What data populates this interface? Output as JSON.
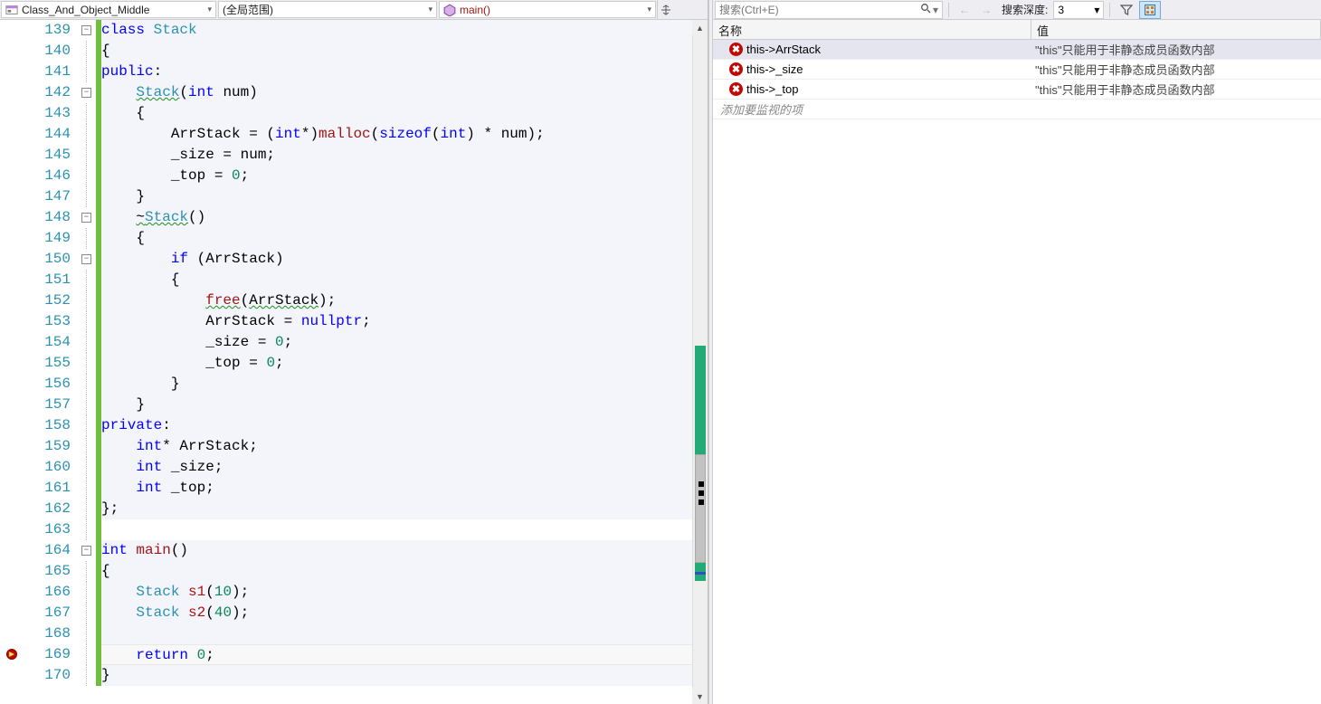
{
  "nav": {
    "project": "Class_And_Object_Middle",
    "scope": "(全局范围)",
    "func": "main()"
  },
  "editor": {
    "lines": [
      {
        "n": 139,
        "fold": "minus",
        "hl": true,
        "html": "<span class='kw'>class</span> <span class='type'>Stack</span>"
      },
      {
        "n": 140,
        "hl": true,
        "html": "{"
      },
      {
        "n": 141,
        "hl": true,
        "html": "<span class='kw'>public</span>:"
      },
      {
        "n": 142,
        "fold": "minus",
        "hl": true,
        "html": "    <span class='type wavy'>Stack</span>(<span class='kw'>int</span> num)"
      },
      {
        "n": 143,
        "hl": true,
        "html": "    {"
      },
      {
        "n": 144,
        "hl": true,
        "html": "        ArrStack = (<span class='kw'>int</span>*)<span class='func'>malloc</span>(<span class='kw'>sizeof</span>(<span class='kw'>int</span>) * num);"
      },
      {
        "n": 145,
        "hl": true,
        "html": "        _size = num;"
      },
      {
        "n": 146,
        "hl": true,
        "html": "        _top = <span class='num'>0</span>;"
      },
      {
        "n": 147,
        "hl": true,
        "html": "    }"
      },
      {
        "n": 148,
        "fold": "minus",
        "hl": true,
        "html": "    <span class='wavy'>~<span class='type'>Stack</span></span>()"
      },
      {
        "n": 149,
        "hl": true,
        "html": "    {"
      },
      {
        "n": 150,
        "fold": "minus",
        "hl": true,
        "html": "        <span class='kw'>if</span> (ArrStack)"
      },
      {
        "n": 151,
        "hl": true,
        "html": "        {"
      },
      {
        "n": 152,
        "hl": true,
        "html": "            <span class='func wavy'>free</span>(<span class='wavy'>ArrStack</span>);"
      },
      {
        "n": 153,
        "hl": true,
        "html": "            ArrStack = <span class='kw'>nullptr</span>;"
      },
      {
        "n": 154,
        "hl": true,
        "html": "            _size = <span class='num'>0</span>;"
      },
      {
        "n": 155,
        "hl": true,
        "html": "            _top = <span class='num'>0</span>;"
      },
      {
        "n": 156,
        "hl": true,
        "html": "        }"
      },
      {
        "n": 157,
        "hl": true,
        "html": "    }"
      },
      {
        "n": 158,
        "hl": true,
        "html": "<span class='kw'>private</span>:"
      },
      {
        "n": 159,
        "hl": true,
        "html": "    <span class='kw'>int</span>* ArrStack;"
      },
      {
        "n": 160,
        "hl": true,
        "html": "    <span class='kw'>int</span> _size;"
      },
      {
        "n": 161,
        "hl": true,
        "html": "    <span class='kw'>int</span> _top;"
      },
      {
        "n": 162,
        "hl": true,
        "html": "};"
      },
      {
        "n": 163,
        "html": ""
      },
      {
        "n": 164,
        "fold": "minus",
        "hl": true,
        "html": "<span class='kw'>int</span> <span class='func'>main</span>()"
      },
      {
        "n": 165,
        "hl": true,
        "html": "{"
      },
      {
        "n": 166,
        "hl": true,
        "html": "    <span class='type'>Stack</span> <span class='func'>s1</span>(<span class='num'>10</span>);"
      },
      {
        "n": 167,
        "hl": true,
        "html": "    <span class='type'>Stack</span> <span class='func'>s2</span>(<span class='num'>40</span>);"
      },
      {
        "n": 168,
        "hl": true,
        "html": ""
      },
      {
        "n": 169,
        "hl": true,
        "bp": true,
        "cur": true,
        "html": "    <span class='kw'>return</span> <span class='num'>0</span>;"
      },
      {
        "n": 170,
        "hl": true,
        "html": "}"
      }
    ]
  },
  "watch": {
    "search_placeholder": "搜索(Ctrl+E)",
    "depth_label": "搜索深度:",
    "depth_value": "3",
    "col_name": "名称",
    "col_value": "值",
    "rows": [
      {
        "name": "this->ArrStack",
        "val": "\"this\"只能用于非静态成员函数内部",
        "sel": true
      },
      {
        "name": "this->_size",
        "val": "\"this\"只能用于非静态成员函数内部"
      },
      {
        "name": "this->_top",
        "val": "\"this\"只能用于非静态成员函数内部"
      }
    ],
    "add_new": "添加要监视的项"
  }
}
